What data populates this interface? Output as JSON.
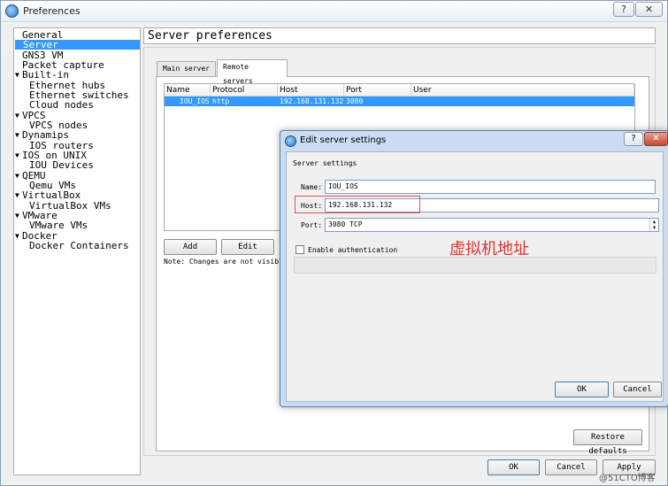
{
  "window": {
    "title": "Preferences",
    "help": "?",
    "close": "✕"
  },
  "sidebar": {
    "items": [
      {
        "label": "General",
        "arrow": ""
      },
      {
        "label": "Server",
        "arrow": ""
      },
      {
        "label": "GNS3 VM",
        "arrow": ""
      },
      {
        "label": "Packet capture",
        "arrow": ""
      },
      {
        "label": "Built-in",
        "arrow": "▼"
      },
      {
        "label": "Ethernet hubs",
        "arrow": ""
      },
      {
        "label": "Ethernet switches",
        "arrow": ""
      },
      {
        "label": "Cloud nodes",
        "arrow": ""
      },
      {
        "label": "VPCS",
        "arrow": "▼"
      },
      {
        "label": "VPCS nodes",
        "arrow": ""
      },
      {
        "label": "Dynamips",
        "arrow": "▼"
      },
      {
        "label": "IOS routers",
        "arrow": ""
      },
      {
        "label": "IOS on UNIX",
        "arrow": "▼"
      },
      {
        "label": "IOU Devices",
        "arrow": ""
      },
      {
        "label": "QEMU",
        "arrow": "▼"
      },
      {
        "label": "Qemu VMs",
        "arrow": ""
      },
      {
        "label": "VirtualBox",
        "arrow": "▼"
      },
      {
        "label": "VirtualBox VMs",
        "arrow": ""
      },
      {
        "label": "VMware",
        "arrow": "▼"
      },
      {
        "label": "VMware VMs",
        "arrow": ""
      },
      {
        "label": "Docker",
        "arrow": "▼"
      },
      {
        "label": "Docker Containers",
        "arrow": ""
      }
    ],
    "selected": "Server"
  },
  "main": {
    "page_title": "Server preferences",
    "tabs": [
      {
        "label": "Main server"
      },
      {
        "label": "Remote servers"
      }
    ],
    "table": {
      "headers": [
        "Name",
        "Protocol",
        "Host",
        "Port",
        "User"
      ],
      "rows": [
        {
          "name": "IOU_IOS",
          "protocol": "http",
          "host": "192.168.131.132",
          "port": "3080",
          "user": ""
        }
      ]
    },
    "add_label": "Add",
    "edit_label": "Edit",
    "note": "Note: Changes are not visible",
    "restore_label": "Restore defaults"
  },
  "footer": {
    "ok": "OK",
    "cancel": "Cancel",
    "apply": "Apply"
  },
  "dialog": {
    "title": "Edit server settings",
    "help": "?",
    "close": "✕",
    "group": "Server settings",
    "name_label": "Name:",
    "name_value": "IOU_IOS",
    "host_label": "Host:",
    "host_value": "192.168.131.132",
    "port_label": "Port:",
    "port_value": "3080 TCP",
    "auth_label": "Enable authentication",
    "ok": "OK",
    "cancel": "Cancel"
  },
  "annotation": {
    "text": "虚拟机地址",
    "color": "#e03030"
  },
  "watermark": "@51CTO博客",
  "colors": {
    "selection": "#3399ff",
    "dialog_frame": "#c9dcf1",
    "annotation": "#e05050"
  }
}
